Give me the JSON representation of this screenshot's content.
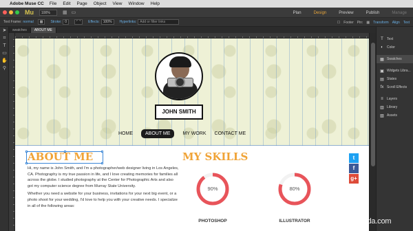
{
  "menubar": {
    "app_name": "Adobe Muse CC",
    "items": [
      "File",
      "Edit",
      "Page",
      "Object",
      "View",
      "Window",
      "Help"
    ]
  },
  "appbar": {
    "logo": "Mu",
    "zoom": "100%",
    "modes": [
      "Plan",
      "Design",
      "Preview",
      "Publish",
      "Manage"
    ],
    "active_mode": "Design"
  },
  "controlbar": {
    "text_frame_label": "Text Frame:",
    "text_frame_value": "normal",
    "stroke_label": "Stroke:",
    "stroke_value": "0",
    "effects_label": "Effects:",
    "opacity_value": "100%",
    "hyperlinks_label": "Hyperlinks:",
    "hyperlinks_placeholder": "Add or filter links",
    "footer_label": "Footer",
    "pin_label": "Pin:",
    "transform_label": "Transform",
    "align_label": "Align",
    "text_label": "Text"
  },
  "doctabs": [
    "swatches",
    "ABOUT ME"
  ],
  "page": {
    "name": "JOHN SMITH",
    "nav": [
      "HOME",
      "ABOUT ME",
      "MY WORK",
      "CONTACT ME"
    ],
    "nav_active": "ABOUT ME",
    "about_title": "ABOUT ME",
    "about_p1": "Hi, my name is John Smith, and I'm a photographer/web designer living in Los Angeles, CA. Photography is my true passion in life, and I love creating memories for families all across the globe. I studied photography at the Center for Photographic Arts and also got my computer science degree from Murray State University.",
    "about_p2": "Whether you need a website for your business, invitations for your next big event, or a photo shoot for your wedding, I'd love to help you with your creative needs. I specialize in all of the following areas:",
    "skills_title": "MY SKILLS",
    "skills": [
      {
        "label": "PHOTOSHOP",
        "value": "90%",
        "fraction": 0.9
      },
      {
        "label": "ILLUSTRATOR",
        "value": "80%",
        "fraction": 0.8
      }
    ],
    "social": [
      {
        "icon": "twitter-icon",
        "glyph": "t",
        "color": "#1da1f2"
      },
      {
        "icon": "facebook-icon",
        "glyph": "f",
        "color": "#3b5998"
      },
      {
        "icon": "google-plus-icon",
        "glyph": "g+",
        "color": "#dd4b39"
      }
    ],
    "accent_color": "#f0a336",
    "gauge_color": "#e8545a"
  },
  "panel": {
    "items": [
      {
        "label": "Text",
        "icon": "T"
      },
      {
        "label": "Color",
        "icon": "◐"
      },
      {
        "label": "Swatches",
        "icon": "▦"
      },
      {
        "label": "Widgets Libra...",
        "icon": "▣"
      },
      {
        "label": "States",
        "icon": "▤"
      },
      {
        "label": "Scroll Effects",
        "icon": "fx"
      },
      {
        "label": "Layers",
        "icon": "≡"
      },
      {
        "label": "Library",
        "icon": "▥"
      },
      {
        "label": "Assets",
        "icon": "▧"
      }
    ],
    "active": "Swatches"
  },
  "watermark": {
    "text": "lynda",
    "suffix": ".com"
  }
}
